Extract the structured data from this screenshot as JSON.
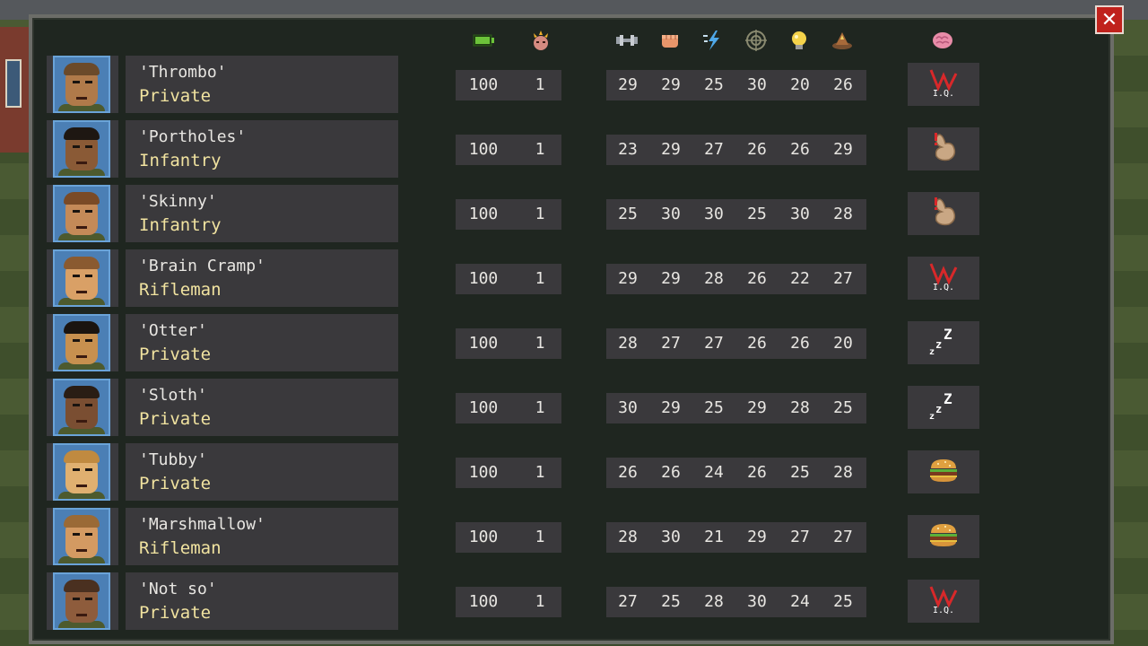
{
  "window": {
    "close_label": "✕"
  },
  "header_icons": [
    "battery-icon",
    "level-icon",
    "strength-icon",
    "fist-icon",
    "speed-icon",
    "crosshair-icon",
    "lightbulb-icon",
    "hat-icon",
    "brain-icon"
  ],
  "soldiers": [
    {
      "nickname": "'Thrombo'",
      "rank": "Private",
      "health": "100",
      "level": "1",
      "stats": [
        "29",
        "29",
        "25",
        "30",
        "20",
        "26"
      ],
      "condition": "low-iq-icon",
      "skin": "#b07a4a",
      "hair": "#6b4a2a"
    },
    {
      "nickname": "'Portholes'",
      "rank": "Infantry",
      "health": "100",
      "level": "1",
      "stats": [
        "23",
        "29",
        "27",
        "26",
        "26",
        "29"
      ],
      "condition": "stomach-icon",
      "skin": "#8a5a36",
      "hair": "#1e1712"
    },
    {
      "nickname": "'Skinny'",
      "rank": "Infantry",
      "health": "100",
      "level": "1",
      "stats": [
        "25",
        "30",
        "30",
        "25",
        "30",
        "28"
      ],
      "condition": "stomach-icon",
      "skin": "#c48a58",
      "hair": "#7a4a26"
    },
    {
      "nickname": "'Brain Cramp'",
      "rank": "Rifleman",
      "health": "100",
      "level": "1",
      "stats": [
        "29",
        "29",
        "28",
        "26",
        "22",
        "27"
      ],
      "condition": "low-iq-icon",
      "skin": "#d9a066",
      "hair": "#8a5a30"
    },
    {
      "nickname": "'Otter'",
      "rank": "Private",
      "health": "100",
      "level": "1",
      "stats": [
        "28",
        "27",
        "27",
        "26",
        "26",
        "20"
      ],
      "condition": "sleep-icon",
      "skin": "#c7904f",
      "hair": "#1a1410"
    },
    {
      "nickname": "'Sloth'",
      "rank": "Private",
      "health": "100",
      "level": "1",
      "stats": [
        "30",
        "29",
        "25",
        "29",
        "28",
        "25"
      ],
      "condition": "sleep-icon",
      "skin": "#7a4e32",
      "hair": "#2a1d14"
    },
    {
      "nickname": "'Tubby'",
      "rank": "Private",
      "health": "100",
      "level": "1",
      "stats": [
        "26",
        "26",
        "24",
        "26",
        "25",
        "28"
      ],
      "condition": "burger-icon",
      "skin": "#e0b070",
      "hair": "#c08a40"
    },
    {
      "nickname": "'Marshmallow'",
      "rank": "Rifleman",
      "health": "100",
      "level": "1",
      "stats": [
        "28",
        "30",
        "21",
        "29",
        "27",
        "27"
      ],
      "condition": "burger-icon",
      "skin": "#d39a62",
      "hair": "#9a6a36"
    },
    {
      "nickname": "'Not so'",
      "rank": "Private",
      "health": "100",
      "level": "1",
      "stats": [
        "27",
        "25",
        "28",
        "30",
        "24",
        "25"
      ],
      "condition": "low-iq-icon",
      "skin": "#8e5c3c",
      "hair": "#4a3020"
    }
  ]
}
